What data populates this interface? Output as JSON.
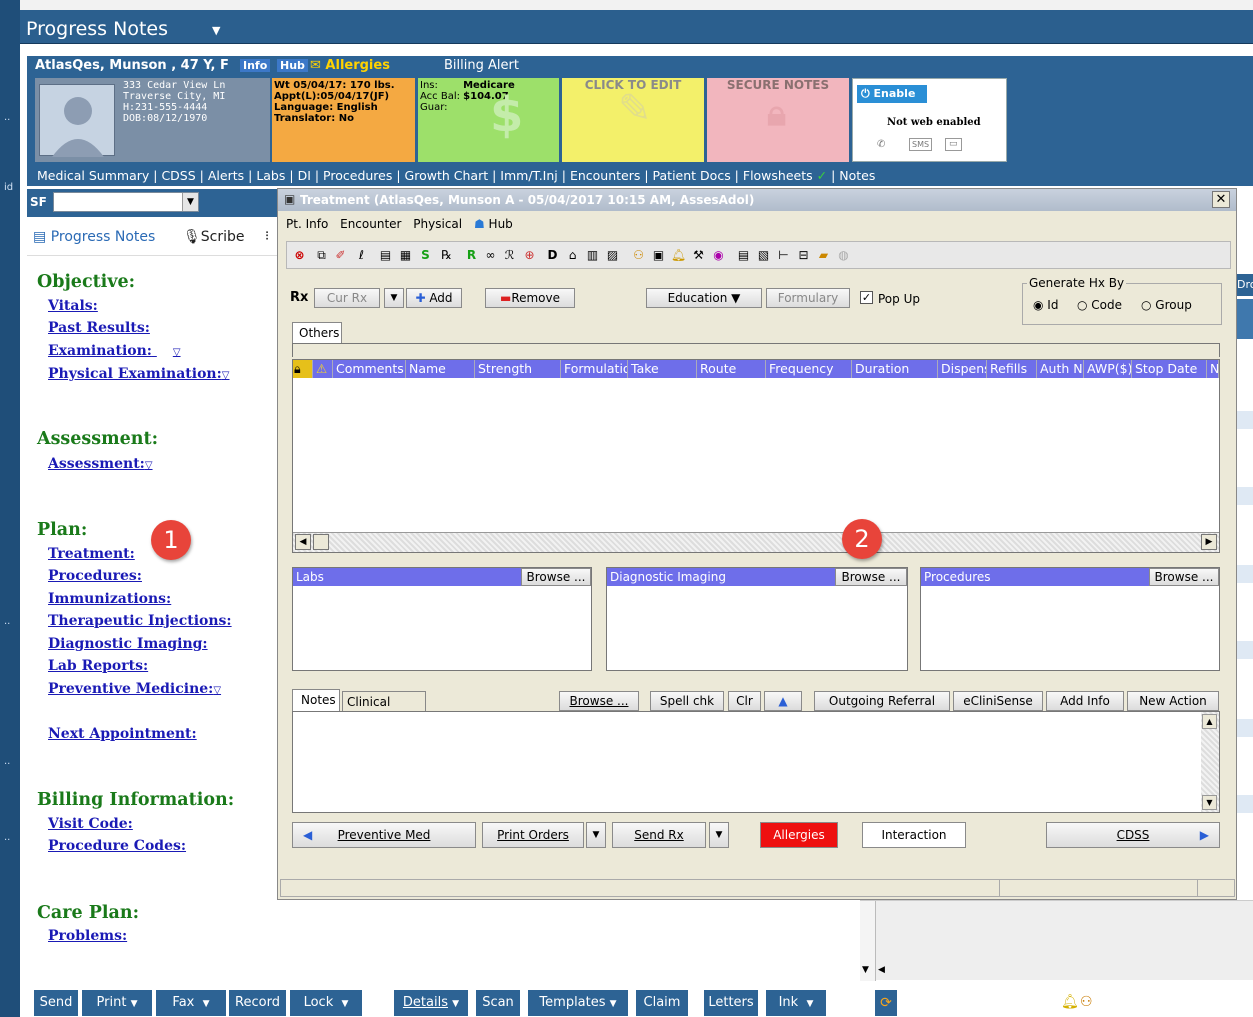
{
  "window": {
    "title": "Progress Notes"
  },
  "patient": {
    "name": "AtlasQes, Munson , 47 Y, F",
    "info_tag": "Info",
    "hub_tag": "Hub",
    "allergies": "Allergies",
    "billing_alert": "Billing Alert",
    "address": [
      "333 Cedar View Ln",
      "Traverse City, MI",
      "H:231-555-4444",
      "DOB:08/12/1970"
    ],
    "wt_card": [
      "Wt 05/04/17: 170 lbs.",
      "Appt(L):05/04/17(JF)",
      "Language: English",
      "Translator: No"
    ],
    "ins_card": {
      "ins_label": "Ins:",
      "ins_value": "Medicare",
      "acc_label": "Acc Bal:",
      "acc_value": "$104.07",
      "guar_label": "Guar:"
    },
    "edit_card": "CLICK TO EDIT",
    "secure_card": "SECURE NOTES",
    "web_card": {
      "enable": "Enable",
      "status": "Not web enabled",
      "sms": "SMS"
    }
  },
  "nav_links": [
    "Medical Summary",
    "CDSS",
    "Alerts",
    "Labs",
    "DI",
    "Procedures",
    "Growth Chart",
    "Imm/T.Inj",
    "Encounters",
    "Patient Docs",
    "Flowsheets",
    "Notes"
  ],
  "left": {
    "sf_label": "SF",
    "tabs": {
      "progress_notes": "Progress Notes",
      "scribe": "Scribe"
    },
    "sections": {
      "objective": "Objective:",
      "vitals": "Vitals:",
      "past_results": "Past Results:",
      "examination": "Examination:",
      "physical_exam": "Physical Examination:",
      "assessment_h": "Assessment:",
      "assessment": "Assessment:",
      "plan": "Plan:",
      "treatment": "Treatment:",
      "procedures": "Procedures:",
      "immunizations": "Immunizations:",
      "therapeutic": "Therapeutic Injections:",
      "diag_imaging": "Diagnostic Imaging:",
      "lab_reports": "Lab Reports:",
      "preventive": "Preventive Medicine:",
      "next_appt": "Next Appointment:",
      "billing": "Billing Information:",
      "visit_code": "Visit Code:",
      "procedure_codes": "Procedure Codes:",
      "care_plan": "Care Plan:",
      "problems": "Problems:"
    },
    "badge1": "1"
  },
  "dialog": {
    "title": "Treatment (AtlasQes, Munson A - 05/04/2017  10:15 AM, AssesAdol)",
    "menu": [
      "Pt. Info",
      "Encounter",
      "Physical",
      "Hub"
    ],
    "rx_label": "Rx",
    "cur_rx": "Cur Rx",
    "add": "Add",
    "remove": "Remove",
    "education": "Education",
    "formulary": "Formulary",
    "popup": "Pop Up",
    "genhx": {
      "title": "Generate Hx By",
      "id": "Id",
      "code": "Code",
      "group": "Group"
    },
    "others_tab": "Others",
    "columns": [
      "Comments",
      "Name",
      "Strength",
      "Formulation",
      "Take",
      "Route",
      "Frequency",
      "Duration",
      "Dispense",
      "Refills",
      "Auth N",
      "AWP($)",
      "Stop Date",
      "N"
    ],
    "labs": "Labs",
    "diag": "Diagnostic Imaging",
    "procs": "Procedures",
    "browse": "Browse ...",
    "badge2": "2",
    "notes_tabs": {
      "notes": "Notes",
      "clinical": "Clinical Notes"
    },
    "notes_btns": {
      "browse": "Browse ...",
      "spell": "Spell chk",
      "clr": "Clr",
      "referral": "Outgoing Referral",
      "ecli": "eCliniSense",
      "addinfo": "Add Info",
      "newaction": "New Action"
    },
    "bottom": {
      "preventive": "Preventive Med",
      "print": "Print Orders",
      "send": "Send Rx",
      "allergies": "Allergies",
      "interaction": "Interaction",
      "cdss": "CDSS"
    }
  },
  "right_label": "Dro",
  "bottom_toolbar": [
    "Send",
    "Print",
    "Fax",
    "Record",
    "Lock",
    "Details",
    "Scan",
    "Templates",
    "Claim",
    "Letters",
    "Ink"
  ],
  "colors": {
    "accent": "#2d6394",
    "link": "#1a1ab5",
    "section": "#1a7a1a",
    "badge": "#e8443a",
    "group_header": "#6e6eea"
  }
}
